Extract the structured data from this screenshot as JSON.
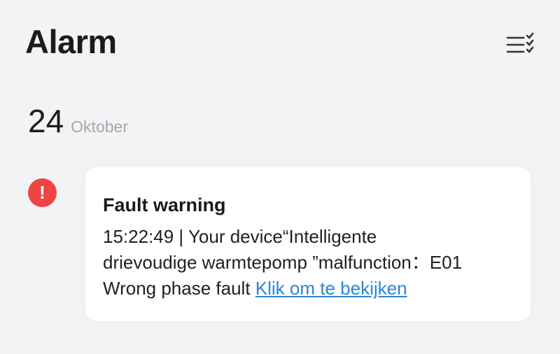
{
  "header": {
    "title": "Alarm",
    "menu_icon": "checklist-icon"
  },
  "date": {
    "day": "24",
    "month": "Oktober"
  },
  "alarm": {
    "status_icon": "exclamation-icon",
    "status_color": "#ef4444",
    "title": "Fault warning",
    "line1": "15:22:49 | Your device“Intelligente",
    "line2": "drievoudige warmtepomp ”malfunction：E01",
    "line3": "Wrong phase fault",
    "link_label": "Klik om te bekijken",
    "link_color": "#2a86d8"
  }
}
